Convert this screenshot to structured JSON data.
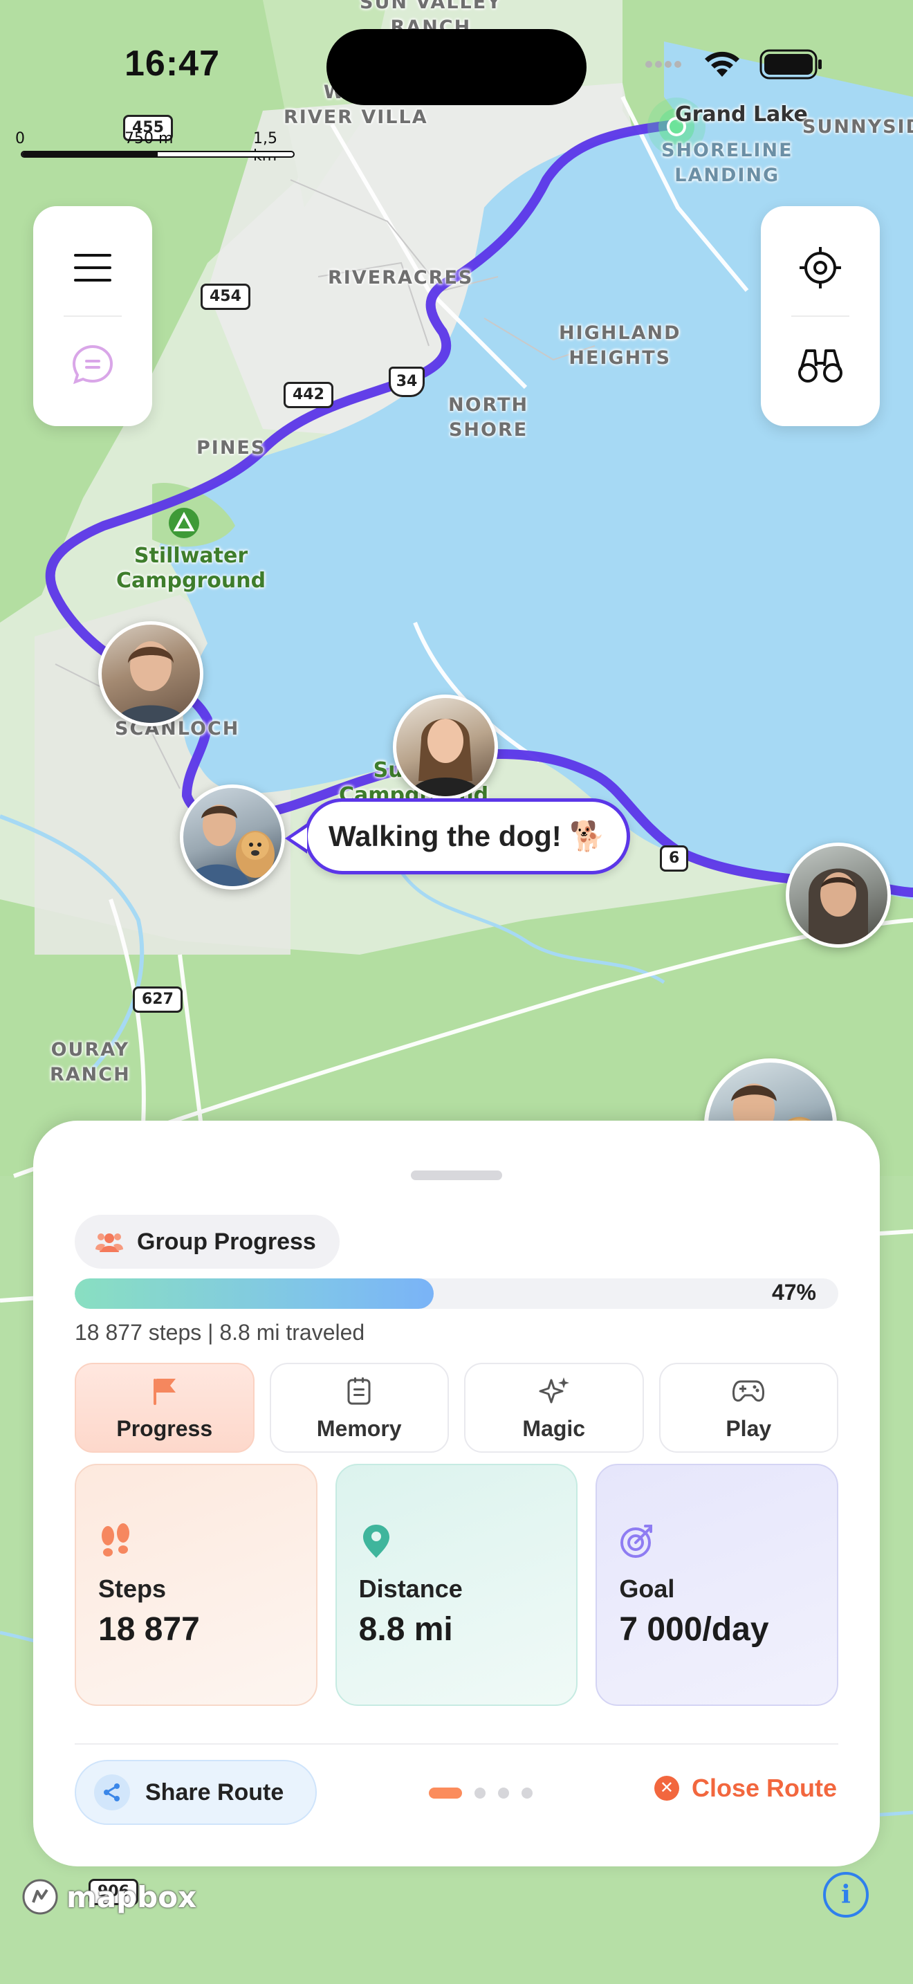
{
  "status_bar": {
    "time": "16:47"
  },
  "scale_bar": {
    "label_start": "0",
    "label_mid": "750 m",
    "label_end": "1,5 km"
  },
  "map": {
    "place_labels": {
      "sun_valley_ranch": "SUN VALLEY\nRANCH",
      "wind_river_villa": "WIND\nRIVER VILLA",
      "grand_lake": "Grand Lake",
      "sunnyside": "SUNNYSIDE",
      "shoreline_landing": "SHORELINE\nLANDING",
      "riveracres": "RIVERACRES",
      "highland_heights": "HIGHLAND\nHEIGHTS",
      "north_shore": "NORTH\nSHORE",
      "pines": "PINES",
      "stillwater": "Stillwater\nCampground",
      "scanloch": "SCANLOCH",
      "sunset_campground": "Sunset\nCampground",
      "ouray_ranch": "OURAY\nRANCH"
    },
    "route_shields": {
      "r455": "455",
      "r454": "454",
      "r442": "442",
      "r34": "34",
      "r6": "6",
      "r627": "627",
      "r906": "906"
    },
    "route_color": "#5b36e8"
  },
  "speech_bubble": {
    "text": "Walking the dog! 🐕"
  },
  "sheet": {
    "group_chip_label": "Group Progress",
    "progress_percent_label": "47%",
    "progress_fraction": 0.47,
    "stats_line": "18 877 steps | 8.8 mi traveled",
    "tabs": [
      {
        "label": "Progress",
        "icon": "flag-icon",
        "active": true
      },
      {
        "label": "Memory",
        "icon": "journal-icon",
        "active": false
      },
      {
        "label": "Magic",
        "icon": "sparkle-icon",
        "active": false
      },
      {
        "label": "Play",
        "icon": "gamepad-icon",
        "active": false
      }
    ],
    "cards": {
      "steps": {
        "label": "Steps",
        "value": "18 877",
        "icon": "footprints-icon"
      },
      "distance": {
        "label": "Distance",
        "value": "8.8 mi",
        "icon": "map-pin-icon"
      },
      "goal": {
        "label": "Goal",
        "value": "7 000/day",
        "icon": "target-icon"
      }
    },
    "share_label": "Share Route",
    "close_label": "Close Route",
    "page_count": 4,
    "active_page": 1
  },
  "brand": {
    "mapbox": "mapbox",
    "info": "i"
  },
  "colors": {
    "accent_orange": "#f2673e",
    "route_purple": "#5b36e8",
    "water": "#a6d9f4",
    "land_green": "#aedb9c"
  }
}
